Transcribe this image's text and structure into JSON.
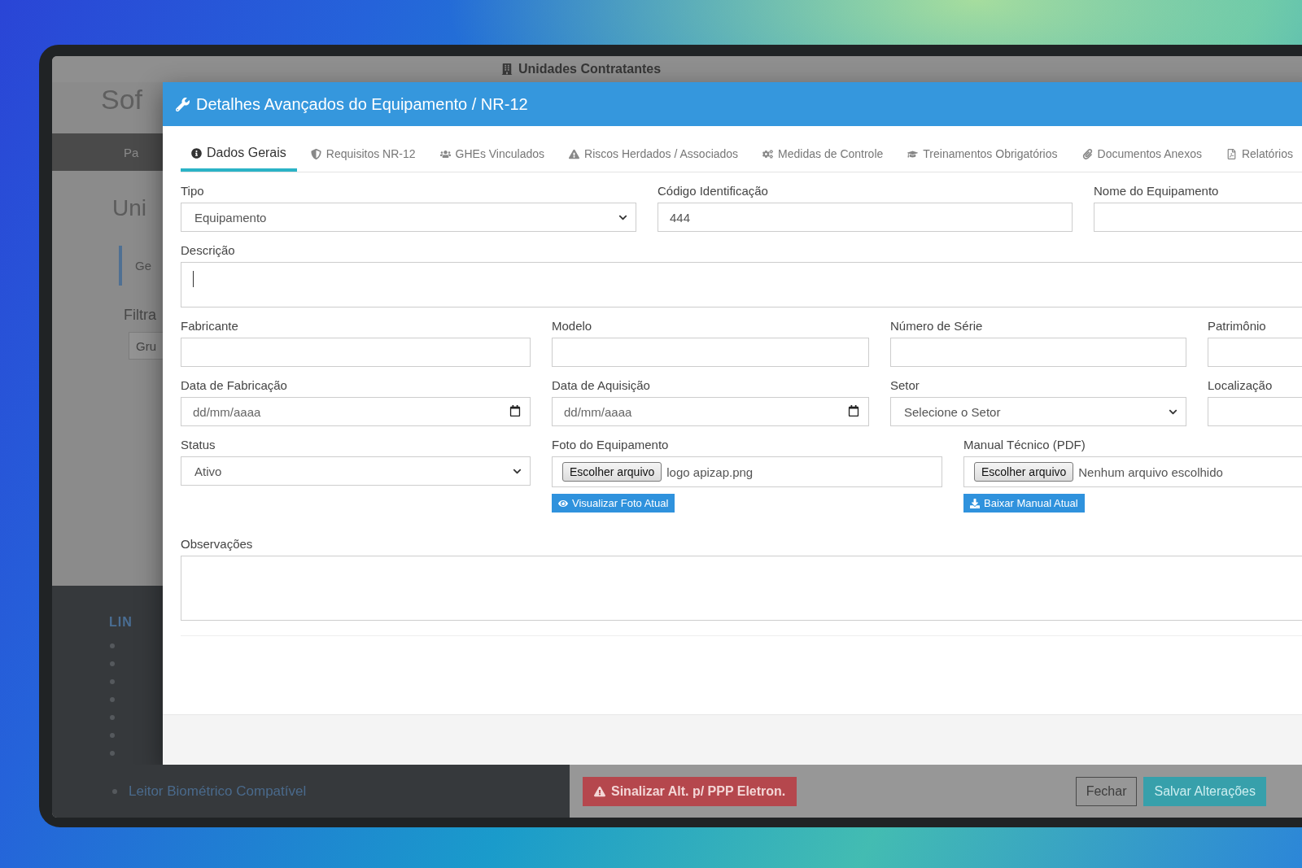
{
  "background": {
    "app_title": "Sof",
    "page_tab": "Unidades Contratantes",
    "nav_item": "Pa",
    "page_title": "Uni",
    "sub_tab": "Ge",
    "filter_label": "Filtra",
    "filter_field": "Gru",
    "links_heading": "LIN",
    "link": "Leitor Biométrico Compatível",
    "alert_button": "Sinalizar Alt. p/ PPP Eletron."
  },
  "modal": {
    "title": "Detalhes Avançados do Equipamento / NR-12",
    "tabs": [
      {
        "label": "Dados Gerais",
        "selected": true
      },
      {
        "label": "Requisitos NR-12",
        "selected": false
      },
      {
        "label": "GHEs Vinculados",
        "selected": false
      },
      {
        "label": "Riscos Herdados / Associados",
        "selected": false
      },
      {
        "label": "Medidas de Controle",
        "selected": false
      },
      {
        "label": "Treinamentos Obrigatórios",
        "selected": false
      },
      {
        "label": "Documentos Anexos",
        "selected": false
      },
      {
        "label": "Relatórios",
        "selected": false
      }
    ],
    "rows": [
      [
        {
          "kind": "select",
          "label": "Tipo",
          "value": "Equipamento"
        },
        {
          "kind": "text",
          "label": "Código Identificação",
          "value": "444"
        },
        {
          "kind": "text",
          "label": "Nome do Equipamento"
        }
      ],
      [
        {
          "kind": "textarea",
          "label": "Descrição",
          "focused": true
        }
      ],
      [
        {
          "kind": "text",
          "label": "Fabricante"
        },
        {
          "kind": "text",
          "label": "Modelo"
        },
        {
          "kind": "text",
          "label": "Número de Série"
        },
        {
          "kind": "text",
          "label": "Patrimônio"
        }
      ],
      [
        {
          "kind": "date",
          "label": "Data de Fabricação",
          "placeholder": "dd/mm/aaaa"
        },
        {
          "kind": "date",
          "label": "Data de Aquisição",
          "placeholder": "dd/mm/aaaa"
        },
        {
          "kind": "select",
          "label": "Setor",
          "value": "Selecione o Setor"
        },
        {
          "kind": "text",
          "label": "Localização"
        }
      ],
      [
        {
          "kind": "select",
          "label": "Status",
          "value": "Ativo"
        },
        {
          "kind": "file",
          "label": "Foto do Equipamento",
          "button": "Escolher arquivo",
          "file_name": "logo apizap.png",
          "action": {
            "label": "Visualizar Foto Atual",
            "kind": "view"
          }
        },
        {
          "kind": "file",
          "label": "Manual Técnico (PDF)",
          "button": "Escolher arquivo",
          "file_name": "Nenhum arquivo escolhido",
          "action": {
            "label": "Baixar Manual Atual",
            "kind": "download"
          }
        }
      ],
      [
        {
          "kind": "textarea",
          "label": "Observações"
        }
      ]
    ],
    "buttons": [
      {
        "label": "Fechar",
        "kind": "secondary"
      },
      {
        "label": "Salvar Alterações",
        "kind": "primary"
      }
    ]
  }
}
